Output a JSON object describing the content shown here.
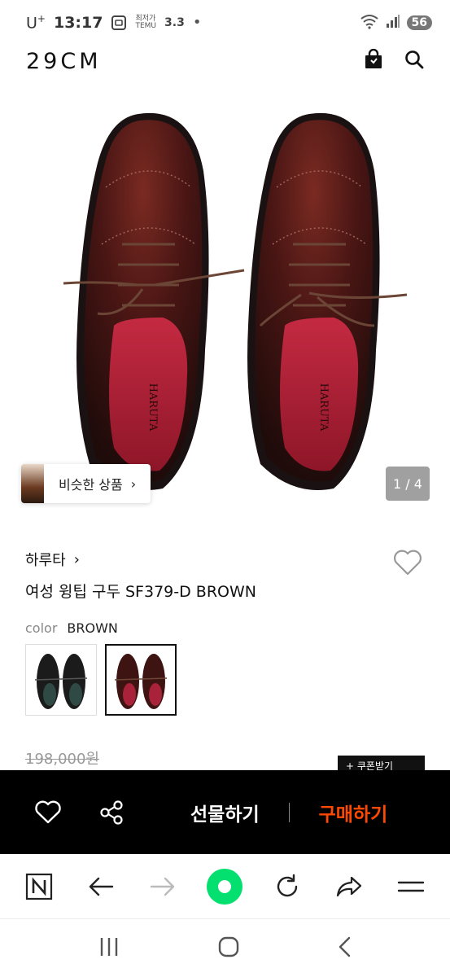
{
  "status_bar": {
    "carrier": "U",
    "carrier_sup": "+",
    "time": "13:17",
    "temu_small_1": "최저가",
    "temu_small_2": "TEMU",
    "temu_rating": "3.3",
    "dot": "•",
    "battery": "56"
  },
  "header": {
    "logo": "29CM",
    "icons": [
      "shopping-bag-icon",
      "search-icon"
    ]
  },
  "hero": {
    "similar_label": "비슷한 상품",
    "similar_chevron": "›",
    "page_counter": "1 / 4",
    "shoe_colors": {
      "leather": "#4a1614",
      "lining": "#b0233a",
      "sole": "#1a1212"
    }
  },
  "product": {
    "brand": "하루타",
    "brand_chevron": "›",
    "name": "여성 윙팁 구두 SF379-D BROWN",
    "color_label": "color",
    "color_value": "BROWN",
    "swatches": [
      {
        "name": "BLACK",
        "selected": false
      },
      {
        "name": "BROWN",
        "selected": true
      }
    ],
    "original_price": "198,000원",
    "coupon_label": "+ 쿠폰받기"
  },
  "cta": {
    "gift_label": "선물하기",
    "buy_label": "구매하기",
    "buy_color": "#ff4800",
    "icons": [
      "heart-icon",
      "share-icon"
    ]
  },
  "browser_toolbar": {
    "icons": [
      "naver-n-icon",
      "back-arrow-icon",
      "forward-arrow-icon",
      "green-home-icon",
      "refresh-icon",
      "share-arrow-icon",
      "menu-icon"
    ],
    "accent": "#03e06f"
  },
  "system_nav": {
    "icons": [
      "recents-icon",
      "home-circle-icon",
      "back-chevron-icon"
    ]
  }
}
